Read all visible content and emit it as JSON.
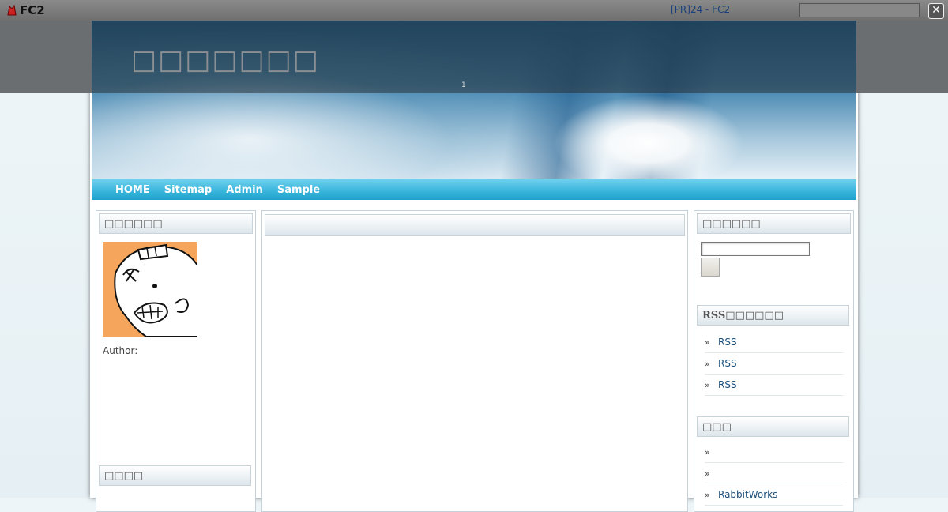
{
  "fc2bar": {
    "logo": "FC2",
    "pr_link": "[PR]24 - FC2",
    "close": "✕"
  },
  "header": {
    "title": "□□□□□□□",
    "page_marker": "1"
  },
  "nav": {
    "items": [
      "HOME",
      "Sitemap",
      "Admin",
      "Sample"
    ]
  },
  "left": {
    "profile_heading": "□□□□□□",
    "author_label": "Author:",
    "second_heading": "□□□□"
  },
  "right": {
    "search_heading": "□□□□□□",
    "rss_heading": "RSS□□□□□□",
    "rss_items": [
      "RSS",
      "RSS",
      "RSS"
    ],
    "links_heading": "□□□",
    "links": [
      "",
      "",
      "RabbitWorks"
    ]
  },
  "colors": {
    "nav": "#3bb6dd",
    "link": "#1b4f7a",
    "avatar_bg": "#f6a65c"
  }
}
